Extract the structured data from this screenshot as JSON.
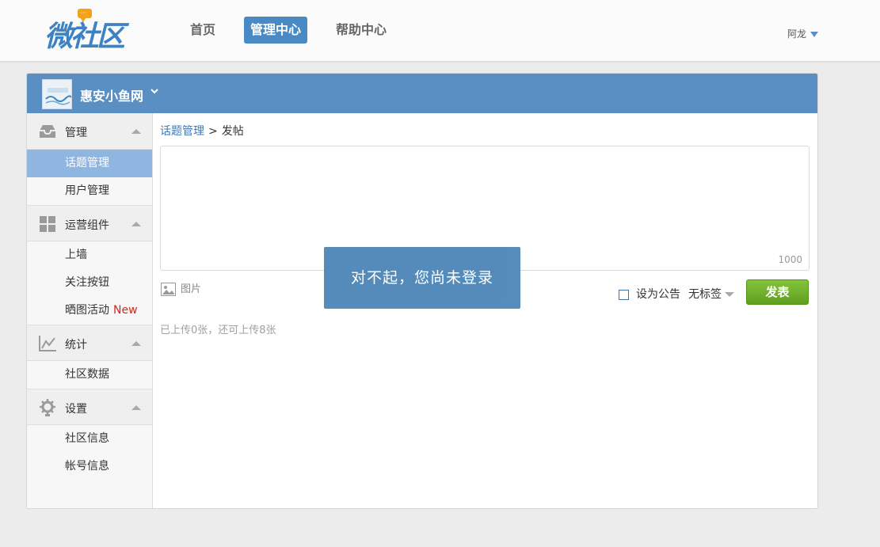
{
  "header": {
    "logo_text": "微社区",
    "nav": [
      {
        "label": "首页",
        "active": false
      },
      {
        "label": "管理中心",
        "active": true
      },
      {
        "label": "帮助中心",
        "active": false
      }
    ],
    "user_name": "阿龙"
  },
  "community": {
    "name": "惠安小鱼网"
  },
  "sidebar": {
    "sections": [
      {
        "label": "管理",
        "icon": "inbox-icon",
        "items": [
          {
            "label": "话题管理",
            "active": true
          },
          {
            "label": "用户管理",
            "active": false
          }
        ]
      },
      {
        "label": "运营组件",
        "icon": "grid-icon",
        "items": [
          {
            "label": "上墙"
          },
          {
            "label": "关注按钮"
          },
          {
            "label": "晒图活动",
            "badge": "New"
          }
        ]
      },
      {
        "label": "统计",
        "icon": "chart-icon",
        "items": [
          {
            "label": "社区数据"
          }
        ]
      },
      {
        "label": "设置",
        "icon": "gear-icon",
        "items": [
          {
            "label": "社区信息"
          },
          {
            "label": "帐号信息"
          }
        ]
      }
    ]
  },
  "content": {
    "breadcrumb": {
      "parent": "话题管理",
      "separator": ">",
      "current": "发帖"
    },
    "editor": {
      "placeholder": "",
      "counter": "1000"
    },
    "image_button": "图片",
    "upload_note": "已上传0张，还可上传8张",
    "announce_label": "设为公告",
    "tag_select": "无标签",
    "post_button": "发表"
  },
  "toast": {
    "message": "对不起，您尚未登录"
  },
  "colors": {
    "accent": "#4a8ac4",
    "header_bar": "#5a8fc4",
    "active_item": "#8fb6e0",
    "post_button": "#6eb02a",
    "new_badge": "#d0281f",
    "toast_bg": "#4f87b8"
  }
}
